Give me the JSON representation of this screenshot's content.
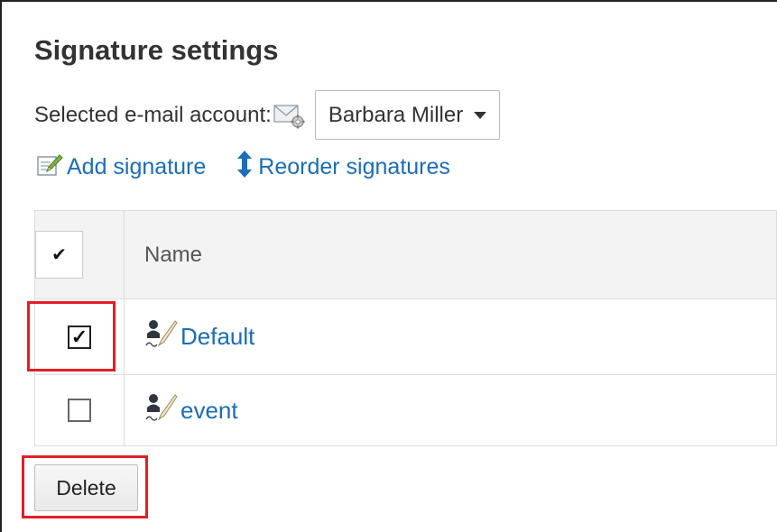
{
  "page": {
    "title": "Signature settings"
  },
  "account": {
    "label": "Selected e-mail account:",
    "icon": "mail-settings-icon",
    "selected": "Barbara Miller"
  },
  "actions": {
    "add_signature": "Add signature",
    "add_icon": "edit-note-icon",
    "reorder_signatures": "Reorder signatures",
    "reorder_icon": "vertical-arrows-icon"
  },
  "table": {
    "header_check": "✔",
    "columns": [
      "Name"
    ],
    "rows": [
      {
        "name": "Default",
        "checked": true
      },
      {
        "name": "event",
        "checked": false
      }
    ]
  },
  "delete_button": "Delete",
  "colors": {
    "link": "#1b6db8",
    "highlight": "#e21e26",
    "header_bg": "#f3f3f3",
    "border": "#dddddd"
  }
}
